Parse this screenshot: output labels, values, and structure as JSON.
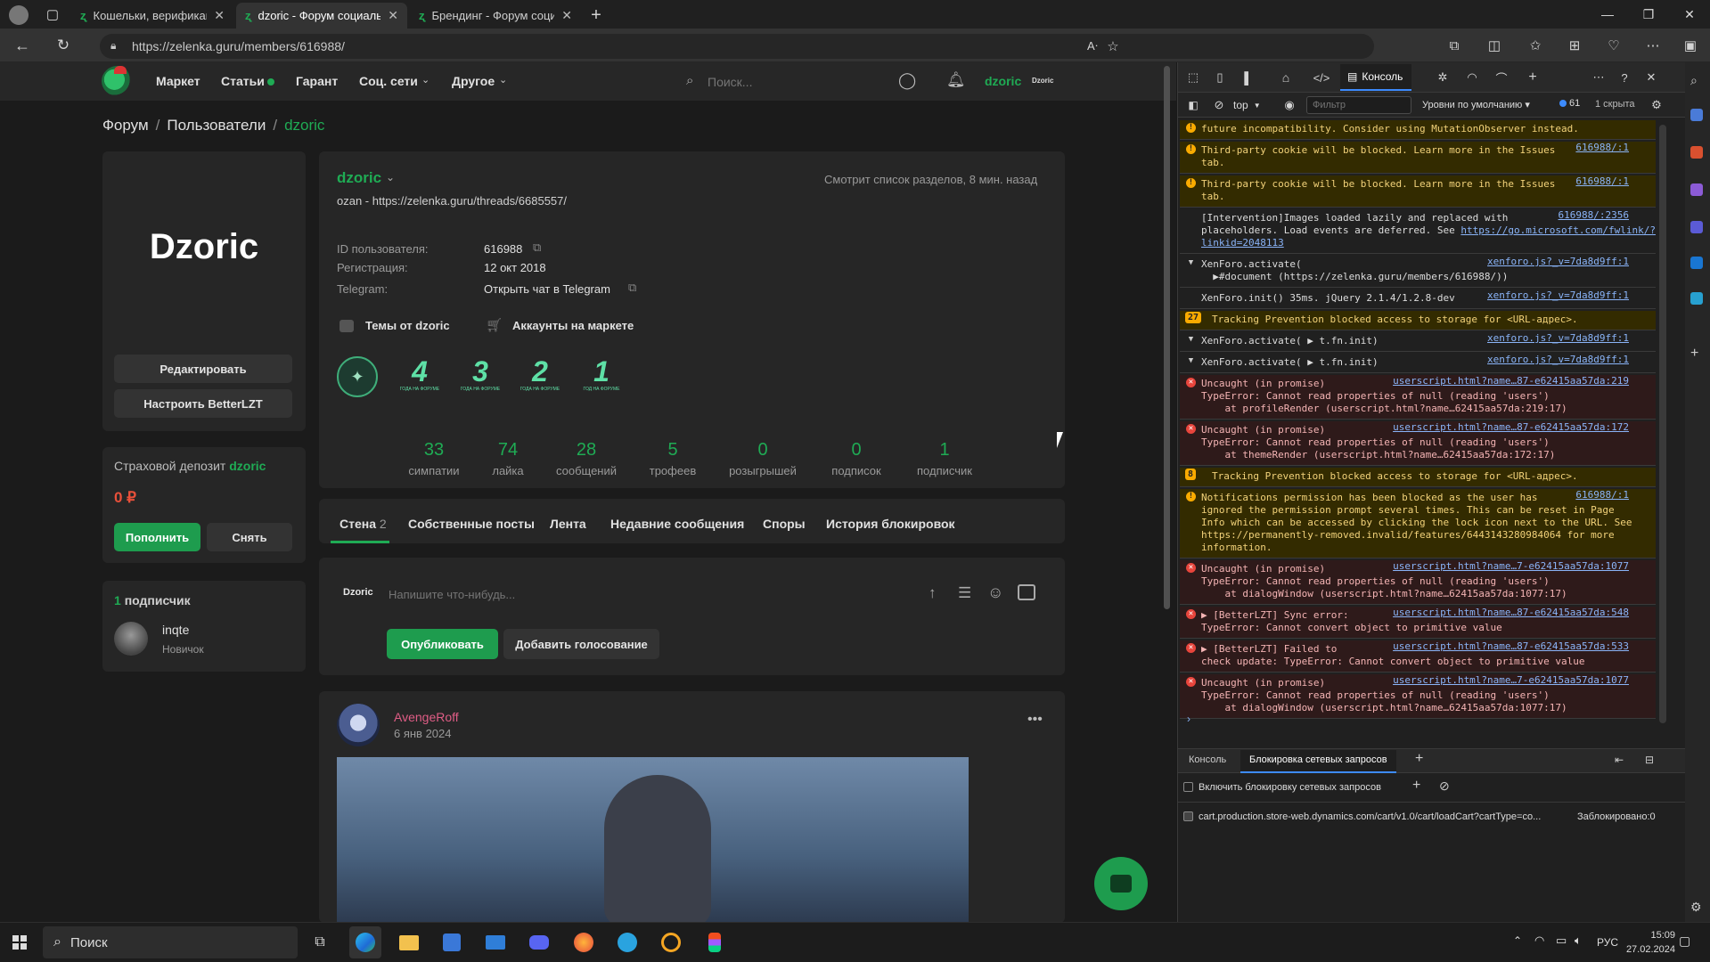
{
  "browser": {
    "tabs": [
      {
        "label": "Кошельки, верификация - Фор"
      },
      {
        "label": "dzoric - Форум социальной ин"
      },
      {
        "label": "Брендинг - Форум социальной"
      }
    ],
    "url": "https://zelenka.guru/members/616988/"
  },
  "site": {
    "nav": {
      "market": "Маркет",
      "articles": "Статьи",
      "guarantor": "Гарант",
      "social": "Соц. сети",
      "other": "Другое",
      "search_placeholder": "Поиск...",
      "username": "dzoric",
      "username_small": "Dzoric"
    },
    "breadcrumb": {
      "forum": "Форум",
      "sep1": "/",
      "users": "Пользователи",
      "sep2": "/",
      "current": "dzoric"
    },
    "sidebar": {
      "avatar_text": "Dzoric",
      "edit_button": "Редактировать",
      "configure_button": "Настроить BetterLZT",
      "deposit_label": "Страховой депозит",
      "deposit_user": "dzoric",
      "deposit_amount": "0 ₽",
      "deposit_topup": "Пополнить",
      "deposit_withdraw": "Снять",
      "followers_count": "1",
      "followers_label": "подписчик",
      "follower": {
        "name": "inqte",
        "rank": "Новичок"
      }
    },
    "profile": {
      "username": "dzoric",
      "status": "ozan - https://zelenka.guru/threads/6685557/",
      "activity": "Смотрит список разделов, 8 мин. назад",
      "fields": [
        {
          "label": "ID пользователя:",
          "value": "616988"
        },
        {
          "label": "Регистрация:",
          "value": "12 окт 2018"
        },
        {
          "label": "Telegram:",
          "value": "Открыть чат в Telegram"
        }
      ],
      "link_themes": "Темы от dzoric",
      "link_accounts": "Аккаунты на маркете",
      "trophies": [
        {
          "big": "",
          "small": ""
        },
        {
          "big": "4",
          "small": "ГОДА НА ФОРУМЕ"
        },
        {
          "big": "3",
          "small": "ГОДА НА ФОРУМЕ"
        },
        {
          "big": "2",
          "small": "ГОДА НА ФОРУМЕ"
        },
        {
          "big": "1",
          "small": "ГОД НА ФОРУМЕ"
        }
      ],
      "stats": [
        {
          "value": "33",
          "label": "симпатии"
        },
        {
          "value": "74",
          "label": "лайка"
        },
        {
          "value": "28",
          "label": "сообщений"
        },
        {
          "value": "5",
          "label": "трофеев"
        },
        {
          "value": "0",
          "label": "розыгрышей"
        },
        {
          "value": "0",
          "label": "подписок"
        },
        {
          "value": "1",
          "label": "подписчик"
        }
      ],
      "tabs": [
        {
          "label": "Стена",
          "count": "2"
        },
        {
          "label": "Собственные посты"
        },
        {
          "label": "Лента"
        },
        {
          "label": "Недавние сообщения"
        },
        {
          "label": "Споры"
        },
        {
          "label": "История блокировок"
        }
      ],
      "composer": {
        "user": "Dzoric",
        "placeholder": "Напишите что-нибудь...",
        "publish": "Опубликовать",
        "add_poll": "Добавить голосование"
      },
      "post": {
        "author": "AvengeRoff",
        "date": "6 янв 2024",
        "more": "•••"
      }
    }
  },
  "devtools": {
    "tabs": {
      "console": "Консоль"
    },
    "context": "top",
    "filter_placeholder": "Фильтр",
    "levels": "Уровни по умолчанию",
    "issues_count": "61",
    "hidden": "1 скрыта",
    "messages": [
      {
        "type": "warn",
        "text": "future incompatibility. Consider using MutationObserver instead.",
        "src": ""
      },
      {
        "type": "warn",
        "text": "Third-party cookie will be blocked. Learn more in the Issues\ntab.",
        "src": "616988/:1"
      },
      {
        "type": "warn",
        "text": "Third-party cookie will be blocked. Learn more in the Issues\ntab.",
        "src": "616988/:1"
      },
      {
        "type": "info",
        "text": "[Intervention]Images loaded lazily and replaced with\nplaceholders. Load events are deferred. See ",
        "link": "https://go.microsoft.com/fwlink/?linkid=2048113",
        "src": "616988/:2356"
      },
      {
        "type": "group",
        "text": "XenForo.activate(\n  ▶#document (https://zelenka.guru/members/616988/))",
        "src": "xenforo.js?_v=7da8d9ff:1"
      },
      {
        "type": "info",
        "text": "XenForo.init() 35ms. jQuery 2.1.4/1.2.8-dev",
        "src": "xenforo.js?_v=7da8d9ff:1"
      },
      {
        "type": "badge",
        "badge": "27",
        "text": "Tracking Prevention blocked access to storage for <URL-адрес>.",
        "src": ""
      },
      {
        "type": "group",
        "text": "XenForo.activate( ▶ t.fn.init)",
        "src": "xenforo.js?_v=7da8d9ff:1"
      },
      {
        "type": "group",
        "text": "XenForo.activate( ▶ t.fn.init)",
        "src": "xenforo.js?_v=7da8d9ff:1"
      },
      {
        "type": "err",
        "text": "Uncaught (in promise)\nTypeError: Cannot read properties of null (reading 'users')\n    at profileRender (userscript.html?name…62415aa57da:219:17)",
        "src": "userscript.html?name…87-e62415aa57da:219"
      },
      {
        "type": "err",
        "text": "Uncaught (in promise)\nTypeError: Cannot read properties of null (reading 'users')\n    at themeRender (userscript.html?name…62415aa57da:172:17)",
        "src": "userscript.html?name…87-e62415aa57da:172"
      },
      {
        "type": "badge",
        "badge": "8",
        "text": "Tracking Prevention blocked access to storage for <URL-адрес>.",
        "src": ""
      },
      {
        "type": "warn",
        "text": "Notifications permission has been blocked as the user has\nignored the permission prompt several times. This can be reset in Page\nInfo which can be accessed by clicking the lock icon next to the URL. See\nhttps://permanently-removed.invalid/features/6443143280984064 for more\ninformation.",
        "src": "616988/:1"
      },
      {
        "type": "err",
        "text": "Uncaught (in promise)\nTypeError: Cannot read properties of null (reading 'users')\n    at dialogWindow (userscript.html?name…62415aa57da:1077:17)",
        "src": "userscript.html?name…7-e62415aa57da:1077"
      },
      {
        "type": "err",
        "text": "▶ [BetterLZT] Sync error:\nTypeError: Cannot convert object to primitive value",
        "src": "userscript.html?name…87-e62415aa57da:548"
      },
      {
        "type": "err",
        "text": "▶ [BetterLZT] Failed to\ncheck update: TypeError: Cannot convert object to primitive value",
        "src": "userscript.html?name…87-e62415aa57da:533"
      },
      {
        "type": "err",
        "text": "Uncaught (in promise)\nTypeError: Cannot read properties of null (reading 'users')\n    at dialogWindow (userscript.html?name…62415aa57da:1077:17)",
        "src": "userscript.html?name…7-e62415aa57da:1077"
      }
    ],
    "drawer": {
      "tab_console": "Консоль",
      "tab_blocking": "Блокировка сетевых запросов",
      "enable_label": "Включить блокировку сетевых запросов",
      "blocked_url": "cart.production.store-web.dynamics.com/cart/v1.0/cart/loadCart?cartType=co...",
      "blocked_status": "Заблокировано:0"
    }
  },
  "taskbar": {
    "search": "Поиск",
    "lang": "РУС",
    "time": "15:09",
    "date": "27.02.2024"
  },
  "colors": {
    "accent": "#1fab54",
    "link": "#8ab4f8",
    "warn_bg": "#332b00",
    "err_bg": "#2e1a1a"
  }
}
